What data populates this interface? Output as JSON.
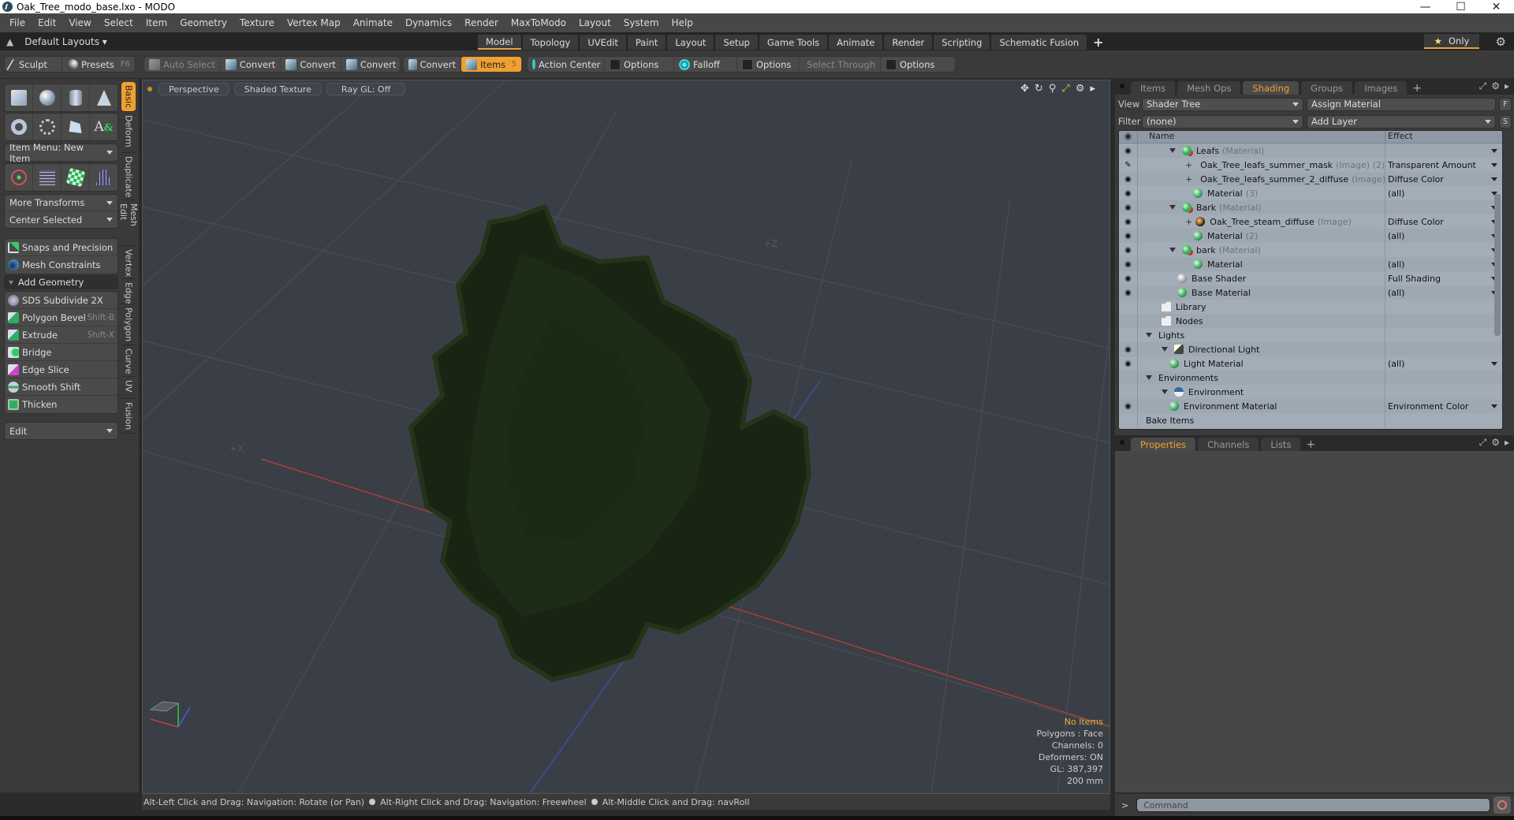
{
  "window": {
    "title": "Oak_Tree_modo_base.lxo - MODO",
    "controls": [
      "minimize",
      "maximize",
      "close"
    ]
  },
  "menu": [
    "File",
    "Edit",
    "View",
    "Select",
    "Item",
    "Geometry",
    "Texture",
    "Vertex Map",
    "Animate",
    "Dynamics",
    "Render",
    "MaxToModo",
    "Layout",
    "System",
    "Help"
  ],
  "layout_bar": {
    "layouts_label": "Default Layouts",
    "tabs": [
      "Model",
      "Topology",
      "UVEdit",
      "Paint",
      "Layout",
      "Setup",
      "Game Tools",
      "Animate",
      "Render",
      "Scripting",
      "Schematic Fusion"
    ],
    "active_tab": "Model",
    "add": "+",
    "only_label": "Only"
  },
  "toolbar": {
    "sculpt": "Sculpt",
    "presets": "Presets",
    "presets_shortcut": "F6",
    "auto_select": "Auto Select",
    "convert1": "Convert",
    "convert2": "Convert",
    "convert3": "Convert",
    "convert4": "Convert",
    "items": "Items",
    "items_badge": "5",
    "action_center": "Action Center",
    "options1": "Options",
    "falloff": "Falloff",
    "options2": "Options",
    "select_through": "Select Through",
    "options3": "Options"
  },
  "left_panel": {
    "item_menu": "Item Menu: New Item",
    "more_transforms": "More Transforms",
    "center_selected": "Center Selected",
    "snaps": "Snaps and Precision",
    "mesh_constraints": "Mesh Constraints",
    "add_geometry": "Add Geometry",
    "tools": [
      {
        "label": "SDS Subdivide 2X",
        "shortcut": ""
      },
      {
        "label": "Polygon Bevel",
        "shortcut": "Shift-B"
      },
      {
        "label": "Extrude",
        "shortcut": "Shift-X"
      },
      {
        "label": "Bridge",
        "shortcut": ""
      },
      {
        "label": "Edge Slice",
        "shortcut": ""
      },
      {
        "label": "Smooth Shift",
        "shortcut": ""
      },
      {
        "label": "Thicken",
        "shortcut": ""
      }
    ],
    "edit": "Edit",
    "vertical_tabs": [
      "Basic",
      "Deform",
      "Duplicate",
      "Mesh Edit",
      "Vertex",
      "Edge",
      "Polygon",
      "Curve",
      "UV",
      "Fusion"
    ],
    "active_vertical_tab": "Basic"
  },
  "viewport": {
    "view": "Perspective",
    "shading": "Shaded Texture",
    "raygl": "Ray GL: Off",
    "axis_z": "+Z",
    "axis_x": "+X",
    "stats": {
      "selection": "No Items",
      "polygons": "Polygons : Face",
      "channels": "Channels: 0",
      "deformers": "Deformers: ON",
      "gl": "GL: 387,397",
      "scale": "200 mm"
    }
  },
  "shading_panel": {
    "tabs": [
      "Items",
      "Mesh Ops",
      "Shading",
      "Groups",
      "Images"
    ],
    "active_tab": "Shading",
    "view_label": "View",
    "view_value": "Shader Tree",
    "assign_material": "Assign Material",
    "f_btn": "F",
    "filter_label": "Filter",
    "filter_value": "(none)",
    "add_layer": "Add Layer",
    "s_btn": "S",
    "col_name": "Name",
    "col_effect": "Effect",
    "rows": [
      {
        "indent": 4,
        "exp": true,
        "icon": "matred",
        "name": "Leafs",
        "sub": "(Material)",
        "effect": "",
        "eye": "eye",
        "dd": true
      },
      {
        "indent": 6,
        "plus": true,
        "icon": "img",
        "name": "Oak_Tree_leafs_summer_mask",
        "sub": "(Image) (2)",
        "effect": "Transparent Amount",
        "eye": "brush",
        "dd": true
      },
      {
        "indent": 6,
        "plus": true,
        "icon": "img",
        "name": "Oak_Tree_leafs_summer_2_diffuse",
        "sub": "(Image)",
        "effect": "Diffuse Color",
        "eye": "eye",
        "dd": true
      },
      {
        "indent": 7,
        "icon": "mat",
        "name": "Material",
        "sub": "(3)",
        "effect": "(all)",
        "eye": "eye",
        "dd": true
      },
      {
        "indent": 4,
        "exp": true,
        "icon": "matred",
        "name": "Bark",
        "sub": "(Material)",
        "effect": "",
        "eye": "eye",
        "dd": true
      },
      {
        "indent": 6,
        "plus": true,
        "icon": "img",
        "name": "Oak_Tree_steam_diffuse",
        "sub": "(Image)",
        "effect": "Diffuse Color",
        "eye": "eye",
        "dd": true
      },
      {
        "indent": 7,
        "icon": "mat",
        "name": "Material",
        "sub": "(2)",
        "effect": "(all)",
        "eye": "eye",
        "dd": true
      },
      {
        "indent": 4,
        "exp": true,
        "icon": "matred",
        "name": "bark",
        "sub": "(Material)",
        "effect": "",
        "eye": "eye",
        "dd": true
      },
      {
        "indent": 7,
        "icon": "mat",
        "name": "Material",
        "sub": "",
        "effect": "(all)",
        "eye": "eye",
        "dd": true
      },
      {
        "indent": 5,
        "icon": "shader",
        "name": "Base Shader",
        "sub": "",
        "effect": "Full Shading",
        "eye": "eye",
        "dd": true
      },
      {
        "indent": 5,
        "icon": "mat",
        "name": "Base Material",
        "sub": "",
        "effect": "(all)",
        "eye": "eye",
        "dd": true
      },
      {
        "indent": 3,
        "icon": "folder",
        "name": "Library",
        "sub": "",
        "effect": "",
        "eye": "",
        "dd": false
      },
      {
        "indent": 3,
        "icon": "folder",
        "name": "Nodes",
        "sub": "",
        "effect": "",
        "eye": "",
        "dd": false
      },
      {
        "indent": 1,
        "exp": true,
        "name": "Lights",
        "sub": "",
        "effect": "",
        "eye": "",
        "dd": false
      },
      {
        "indent": 3,
        "exp": true,
        "icon": "light",
        "name": "Directional Light",
        "sub": "",
        "effect": "",
        "eye": "eye",
        "dd": false
      },
      {
        "indent": 4,
        "icon": "mat",
        "name": "Light Material",
        "sub": "",
        "effect": "(all)",
        "eye": "eye",
        "dd": true
      },
      {
        "indent": 1,
        "exp": true,
        "name": "Environments",
        "sub": "",
        "effect": "",
        "eye": "",
        "dd": false
      },
      {
        "indent": 3,
        "exp": true,
        "icon": "env",
        "name": "Environment",
        "sub": "",
        "effect": "",
        "eye": "",
        "dd": false
      },
      {
        "indent": 4,
        "icon": "mat",
        "name": "Environment Material",
        "sub": "",
        "effect": "Environment Color",
        "eye": "eye",
        "dd": true
      },
      {
        "indent": 1,
        "name": "Bake Items",
        "sub": "",
        "effect": "",
        "eye": "",
        "dd": false
      }
    ]
  },
  "properties_panel": {
    "tabs": [
      "Properties",
      "Channels",
      "Lists"
    ],
    "active_tab": "Properties"
  },
  "statusbar": {
    "hints": [
      "Alt-Left Click and Drag: Navigation: Rotate (or Pan)",
      "Alt-Right Click and Drag: Navigation: Freewheel",
      "Alt-Middle Click and Drag: navRoll"
    ]
  },
  "command": {
    "prompt": ">",
    "placeholder": "Command"
  },
  "colors": {
    "accent": "#f0a030",
    "viewport_bg": "#3a3f47",
    "tree_bg": "#a3adb8"
  }
}
